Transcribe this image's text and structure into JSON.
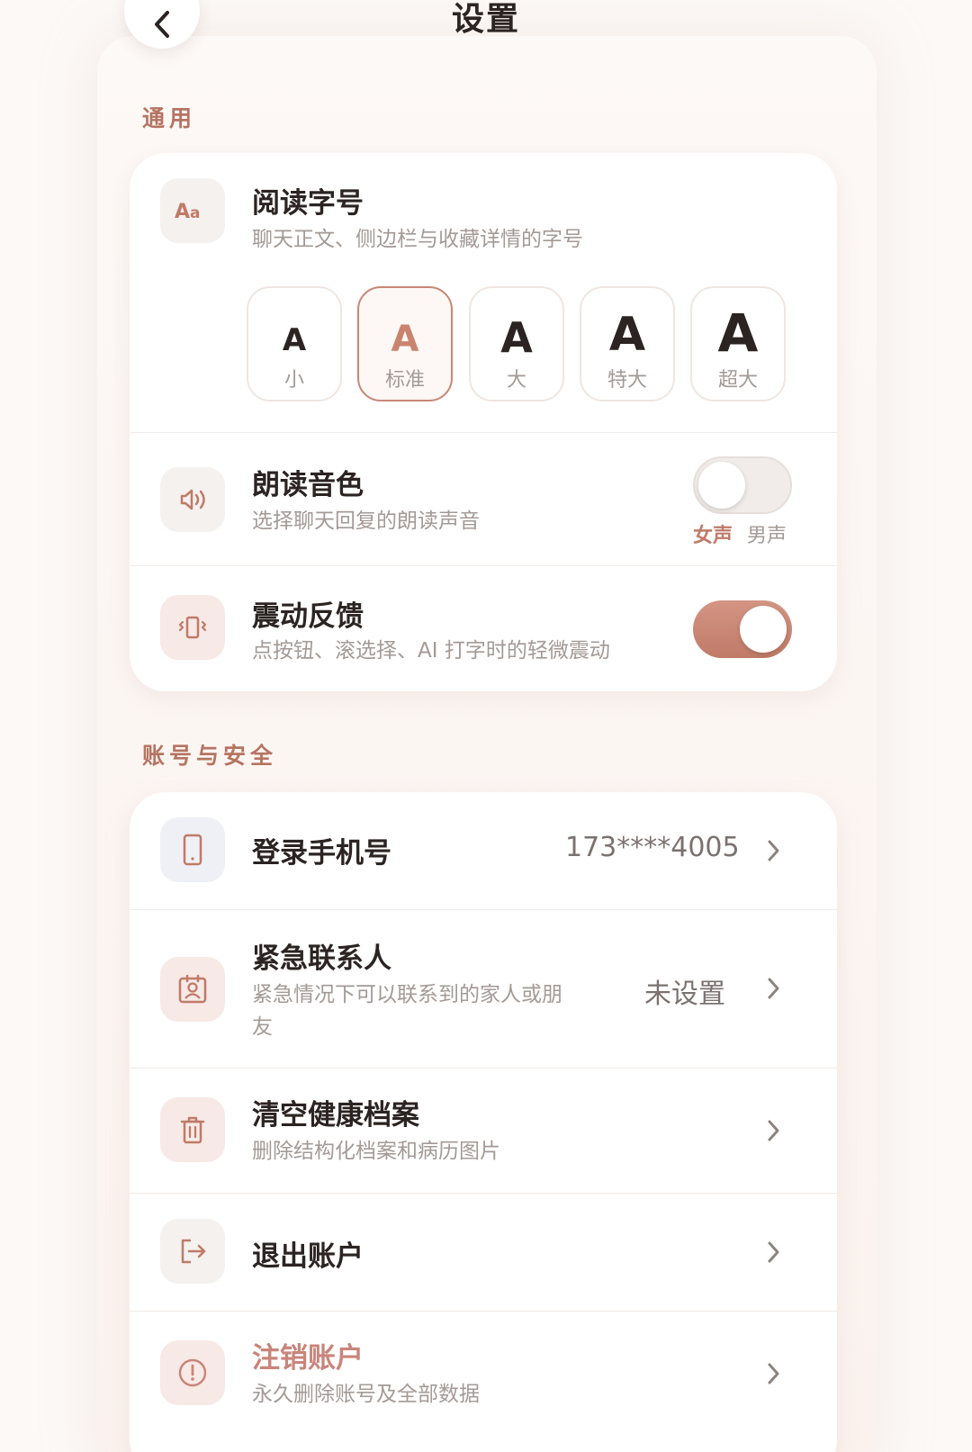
{
  "header": {
    "title": "设置",
    "back_icon": "chevron-left-icon"
  },
  "sections": {
    "general": {
      "label": "通用"
    },
    "account": {
      "label": "账号与安全"
    }
  },
  "font_size": {
    "title": "阅读字号",
    "subtitle": "聊天正文、侧边栏与收藏详情的字号",
    "icon": "font-size-icon",
    "selected": "标准",
    "options": [
      {
        "glyph": "A",
        "label": "小"
      },
      {
        "glyph": "A",
        "label": "标准"
      },
      {
        "glyph": "A",
        "label": "大"
      },
      {
        "glyph": "A",
        "label": "特大"
      },
      {
        "glyph": "A",
        "label": "超大"
      }
    ]
  },
  "voice": {
    "title": "朗读音色",
    "subtitle": "选择聊天回复的朗读声音",
    "icon": "speaker-icon",
    "toggle_on": false,
    "female_label": "女声",
    "male_label": "男声",
    "selected": "女声"
  },
  "vibration": {
    "title": "震动反馈",
    "subtitle": "点按钮、滚选择、AI 打字时的轻微震动",
    "icon": "vibration-icon",
    "toggle_on": true
  },
  "account": {
    "phone": {
      "title": "登录手机号",
      "value": "173****4005",
      "icon": "phone-icon"
    },
    "emergency": {
      "title": "紧急联系人",
      "subtitle_line1": "紧急情况下可以联系到的家人或朋",
      "subtitle_line2": "友",
      "value": "未设置",
      "icon": "contact-card-icon"
    },
    "clear": {
      "title": "清空健康档案",
      "subtitle": "删除结构化档案和病历图片",
      "icon": "trash-icon"
    },
    "logout": {
      "title": "退出账户",
      "icon": "logout-icon"
    },
    "delete": {
      "title": "注销账户",
      "subtitle": "永久删除账号及全部数据",
      "icon": "alert-circle-icon"
    }
  },
  "colors": {
    "accent": "#c07a68",
    "section_label": "#b57462",
    "danger": "#c9857a"
  }
}
